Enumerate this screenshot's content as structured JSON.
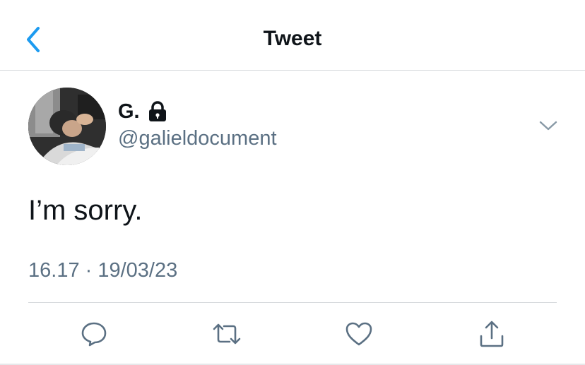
{
  "header": {
    "title": "Tweet",
    "back_icon": "chevron-left-icon"
  },
  "tweet": {
    "author": {
      "display_name": "G.",
      "handle": "@galieldocument",
      "protected_icon": "lock-icon",
      "avatar": "profile photo"
    },
    "text": "I’m sorry.",
    "timestamp": "16.17 · 19/03/23",
    "more_icon": "chevron-down-icon"
  },
  "actions": [
    {
      "name": "reply",
      "icon": "speech-bubble-icon"
    },
    {
      "name": "retweet",
      "icon": "retweet-icon"
    },
    {
      "name": "like",
      "icon": "heart-icon"
    },
    {
      "name": "share",
      "icon": "share-icon"
    }
  ],
  "colors": {
    "accent": "#1d9bf0",
    "text_primary": "#0f1419",
    "text_secondary": "#5b7083",
    "divider": "#d7dadd"
  }
}
